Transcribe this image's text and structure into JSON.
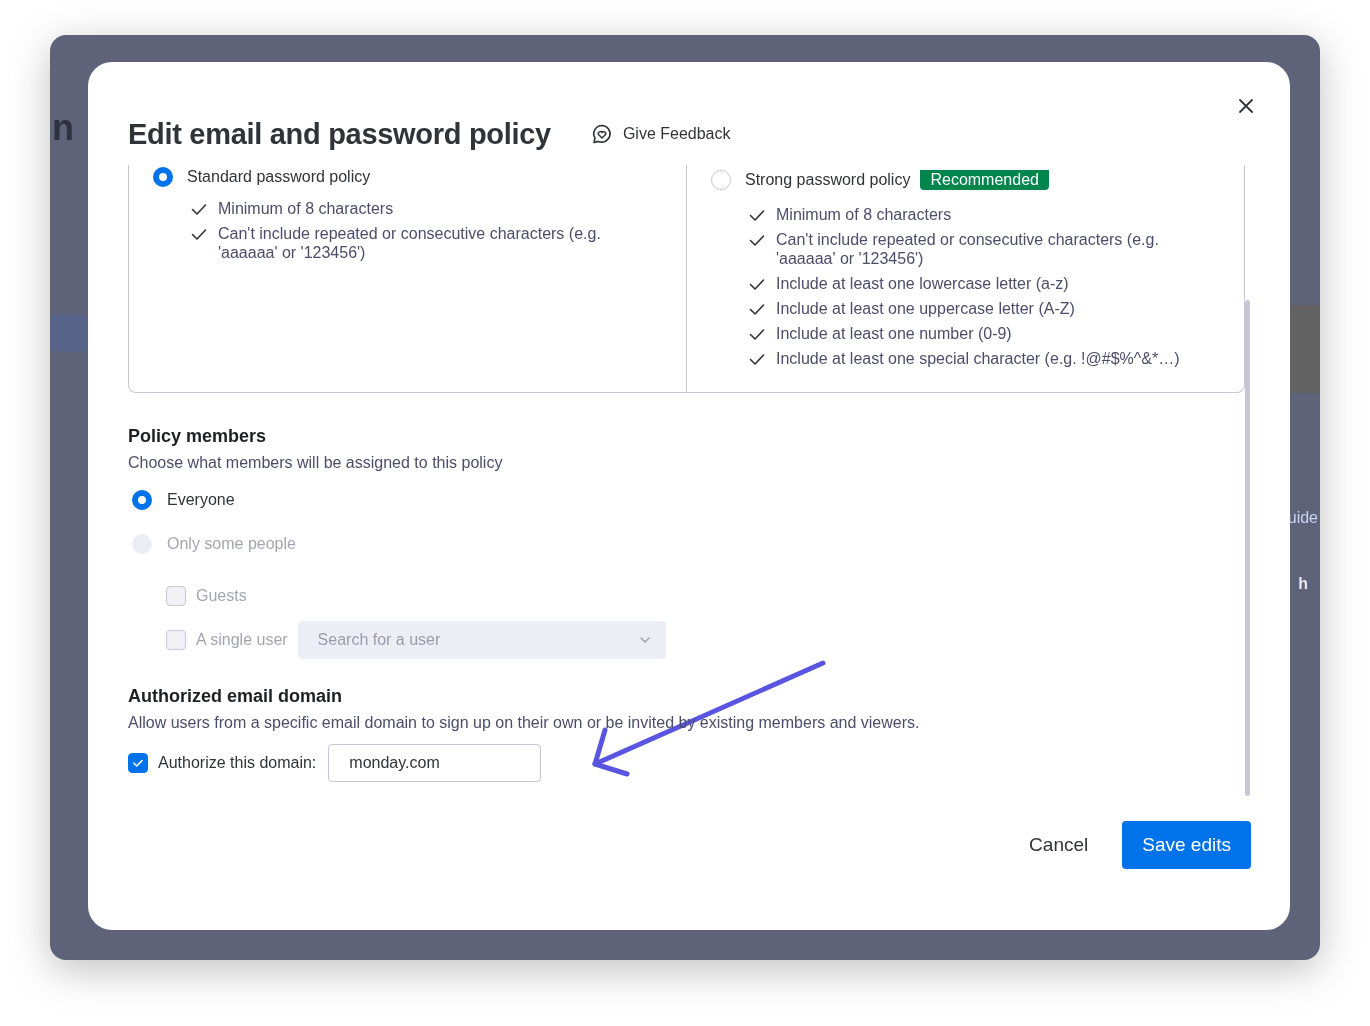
{
  "background": {
    "fragments": [
      {
        "text": "n",
        "kind": "heading"
      },
      {
        "text": "uide",
        "kind": "link"
      },
      {
        "text": "h",
        "kind": "bold"
      }
    ]
  },
  "modal": {
    "title": "Edit email and password policy",
    "feedback": "Give Feedback"
  },
  "policies": [
    {
      "label": "Standard password policy",
      "selected": true,
      "rules": [
        "Minimum of 8 characters",
        "Can't include repeated or consecutive characters (e.g. 'aaaaaa' or '123456')"
      ]
    },
    {
      "label": "Strong password policy",
      "selected": false,
      "badge": "Recommended",
      "rules": [
        "Minimum of 8 characters",
        "Can't include repeated or consecutive characters (e.g. 'aaaaaa' or '123456')",
        "Include at least one lowercase letter (a-z)",
        "Include at least one uppercase letter (A-Z)",
        "Include at least one number (0-9)",
        "Include at least one special character (e.g. !@#$%^&*…)"
      ]
    }
  ],
  "members": {
    "heading": "Policy members",
    "description": "Choose what members will be assigned to this policy",
    "options": [
      {
        "label": "Everyone",
        "selected": true,
        "disabled": false
      },
      {
        "label": "Only some people",
        "selected": false,
        "disabled": true
      }
    ],
    "sub_options": [
      {
        "label": "Guests",
        "checked": false,
        "disabled": true
      },
      {
        "label": "A single user",
        "checked": false,
        "disabled": true,
        "dropdown": {
          "placeholder": "Search for a user"
        }
      }
    ]
  },
  "domain": {
    "heading": "Authorized email domain",
    "description": "Allow users from a specific email domain to sign up on their own or be invited by existing members and viewers.",
    "checkbox": {
      "label": "Authorize this domain:",
      "checked": true
    },
    "input": {
      "value": "monday.com"
    }
  },
  "footer": {
    "buttons": [
      {
        "label": "Cancel",
        "kind": "secondary"
      },
      {
        "label": "Save edits",
        "kind": "primary"
      }
    ]
  }
}
